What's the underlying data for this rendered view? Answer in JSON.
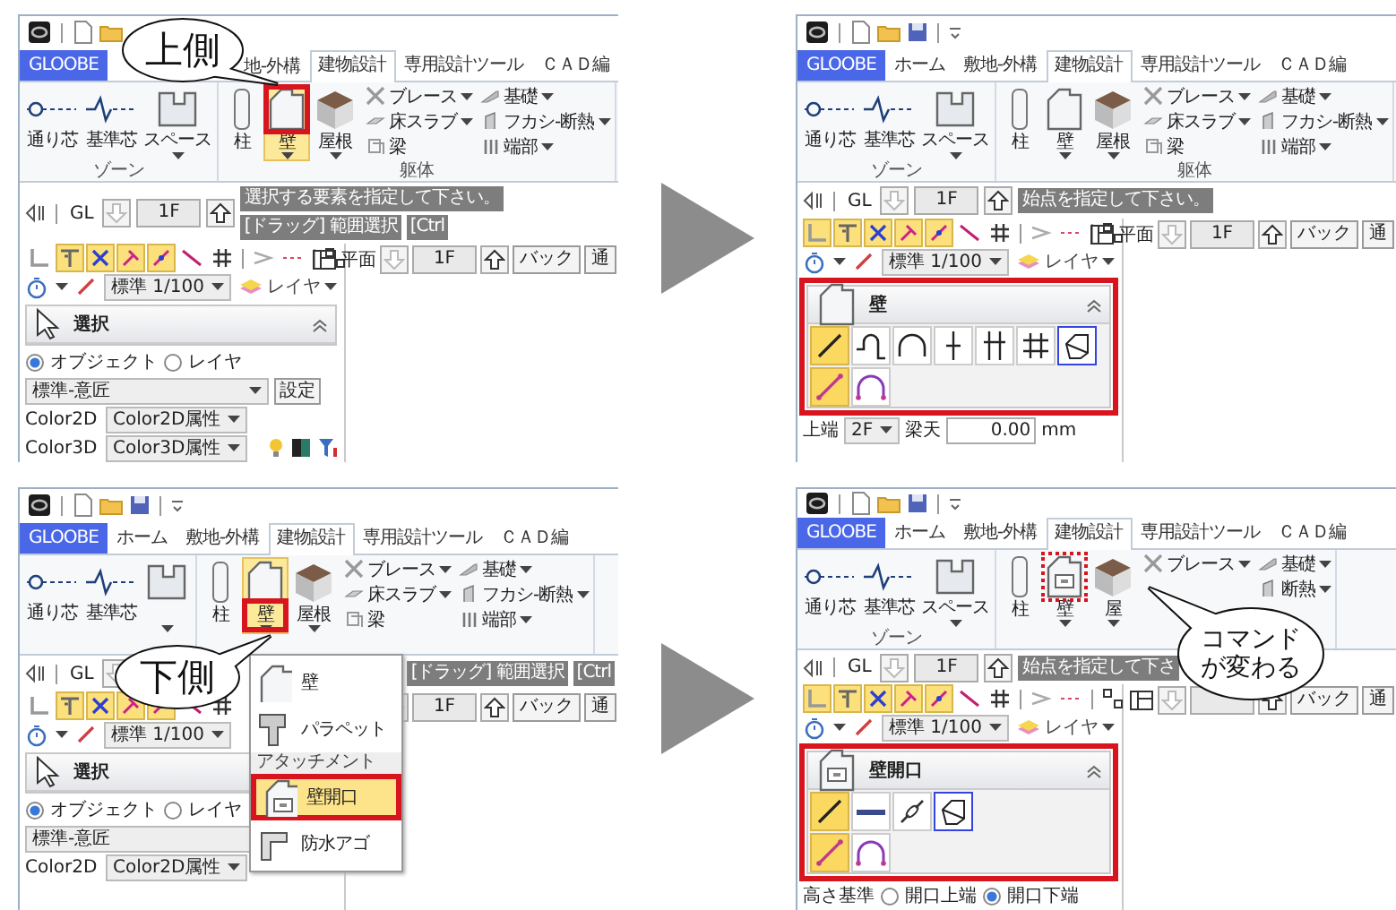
{
  "panels": [
    {
      "quick_access": [
        {
          "kind": "app"
        },
        {
          "kind": "doc"
        },
        {
          "kind": "folder"
        }
      ],
      "tabs": [
        {
          "label": "GLOOBE",
          "kind": "app",
          "selected": false
        },
        {
          "label": "地-外構",
          "kind": "partial",
          "selected": false
        },
        {
          "label": "建物設計",
          "kind": "tab",
          "selected": true
        },
        {
          "label": "専用設計ツール",
          "kind": "tab",
          "selected": false
        },
        {
          "label": "ＣＡＤ編",
          "kind": "tab",
          "selected": false
        }
      ],
      "zone": {
        "items": [
          {
            "label": "通り芯",
            "kind": "grid",
            "dropdown": false
          },
          {
            "label": "基準芯",
            "kind": "ref",
            "dropdown": false
          },
          {
            "label": "スペース",
            "kind": "space",
            "dropdown": true
          }
        ],
        "label": "ゾーン"
      },
      "body": {
        "items": [
          {
            "label": "柱",
            "kind": "column",
            "selected": false,
            "dropdown": false,
            "highlight": false
          },
          {
            "label": "壁",
            "kind": "wall",
            "selected": true,
            "dropdown": true,
            "highlight": true,
            "frame_on_label": false,
            "dotted": false
          },
          {
            "label": "屋根",
            "kind": "roof",
            "selected": false,
            "dropdown": true,
            "highlight": false
          }
        ],
        "small_columns": [
          [
            {
              "label": "ブレース",
              "kind": "brace",
              "dropdown": true
            },
            {
              "label": "床スラブ",
              "kind": "slab",
              "dropdown": true
            },
            {
              "label": "梁",
              "kind": "beam",
              "dropdown": false
            }
          ],
          [
            {
              "label": "基礎",
              "kind": "found",
              "dropdown": true
            },
            {
              "label": "フカシ-断熱",
              "kind": "fukashi",
              "dropdown": true
            },
            {
              "label": "端部",
              "kind": "end",
              "dropdown": true
            }
          ]
        ],
        "label": "躯体"
      },
      "level_bar": {
        "base": "GL",
        "floor": "1F",
        "messages": [
          "選択する要素を指定して下さい。",
          "[ドラッグ] 範囲選択",
          "[Ctrl"
        ]
      },
      "snap_tools": [
        {
          "kind": "corner",
          "selected": false
        },
        {
          "kind": "tee",
          "selected": true
        },
        {
          "kind": "cross",
          "selected": true
        },
        {
          "kind": "pin",
          "selected": true
        },
        {
          "kind": "diag",
          "selected": true
        },
        {
          "kind": "line",
          "selected": false
        },
        {
          "kind": "hash",
          "selected": false
        },
        {
          "kind": "chev",
          "selected": false
        },
        {
          "kind": "dash",
          "selected": false
        },
        {
          "kind": "dxdy",
          "selected": false
        }
      ],
      "scale": "標準 1/100",
      "layer": "レイヤ",
      "view_bar": {
        "view": "平面",
        "floor": "1F",
        "back": "バック",
        "mode": "通"
      },
      "command_panel": {
        "kind": "select",
        "title": "選択",
        "highlighted": false,
        "radios": [
          {
            "label": "オブジェクト",
            "selected": true
          },
          {
            "label": "レイヤ",
            "selected": false
          }
        ],
        "preset": "標準-意匠",
        "settings": "設定",
        "colors": [
          {
            "label": "Color2D",
            "value": "Color2D属性"
          },
          {
            "label": "Color3D",
            "value": "Color3D属性"
          }
        ]
      },
      "callout": {
        "lines": [
          "上側"
        ]
      }
    },
    {
      "quick_access": [
        {
          "kind": "app"
        },
        {
          "kind": "doc"
        },
        {
          "kind": "folder"
        },
        {
          "kind": "save"
        },
        {
          "kind": "qa"
        }
      ],
      "tabs": [
        {
          "label": "GLOOBE",
          "kind": "app",
          "selected": false
        },
        {
          "label": "ホーム",
          "kind": "tab",
          "selected": false
        },
        {
          "label": "敷地-外構",
          "kind": "tab",
          "selected": false
        },
        {
          "label": "建物設計",
          "kind": "tab",
          "selected": true
        },
        {
          "label": "専用設計ツール",
          "kind": "tab",
          "selected": false
        },
        {
          "label": "ＣＡＤ編",
          "kind": "tab",
          "selected": false
        }
      ],
      "zone": {
        "items": [
          {
            "label": "通り芯",
            "kind": "grid",
            "dropdown": false
          },
          {
            "label": "基準芯",
            "kind": "ref",
            "dropdown": false
          },
          {
            "label": "スペース",
            "kind": "space",
            "dropdown": true
          }
        ],
        "label": "ゾーン"
      },
      "body": {
        "items": [
          {
            "label": "柱",
            "kind": "column",
            "selected": false,
            "dropdown": false,
            "highlight": false
          },
          {
            "label": "壁",
            "kind": "wall",
            "selected": false,
            "dropdown": true,
            "highlight": false
          },
          {
            "label": "屋根",
            "kind": "roof",
            "selected": false,
            "dropdown": true,
            "highlight": false
          }
        ],
        "small_columns": [
          [
            {
              "label": "ブレース",
              "kind": "brace",
              "dropdown": true
            },
            {
              "label": "床スラブ",
              "kind": "slab",
              "dropdown": true
            },
            {
              "label": "梁",
              "kind": "beam",
              "dropdown": false
            }
          ],
          [
            {
              "label": "基礎",
              "kind": "found",
              "dropdown": true
            },
            {
              "label": "フカシ-断熱",
              "kind": "fukashi",
              "dropdown": true
            },
            {
              "label": "端部",
              "kind": "end",
              "dropdown": true
            }
          ]
        ],
        "label": "躯体"
      },
      "level_bar": {
        "base": "GL",
        "floor": "1F",
        "messages": [
          "始点を指定して下さい。"
        ]
      },
      "snap_tools": [
        {
          "kind": "corner",
          "selected": true
        },
        {
          "kind": "tee",
          "selected": true
        },
        {
          "kind": "cross",
          "selected": true
        },
        {
          "kind": "pin",
          "selected": true
        },
        {
          "kind": "diag",
          "selected": true
        },
        {
          "kind": "line",
          "selected": false
        },
        {
          "kind": "hash",
          "selected": false
        },
        {
          "kind": "chev",
          "selected": false
        },
        {
          "kind": "dash",
          "selected": false
        },
        {
          "kind": "dxdy",
          "selected": false
        }
      ],
      "scale": "標準 1/100",
      "layer": "レイヤ",
      "view_bar": {
        "view": "平面",
        "floor": "1F",
        "back": "バック",
        "mode": "通"
      },
      "command_panel": {
        "kind": "wall",
        "title": "壁",
        "highlighted": true,
        "tool_rows": [
          [
            {
              "kind": "line",
              "selected": true,
              "outlined": false
            },
            {
              "kind": "polyarc",
              "selected": false,
              "outlined": false
            },
            {
              "kind": "arc",
              "selected": false,
              "outlined": false
            },
            {
              "kind": "split",
              "selected": false,
              "outlined": false
            },
            {
              "kind": "split2",
              "selected": false,
              "outlined": false
            },
            {
              "kind": "grid",
              "selected": false,
              "outlined": false
            },
            {
              "kind": "region",
              "selected": false,
              "outlined": true
            }
          ],
          [
            {
              "kind": "line2",
              "selected": true,
              "outlined": false
            },
            {
              "kind": "arc2",
              "selected": false,
              "outlined": false
            }
          ]
        ],
        "top_row": {
          "label": "上端",
          "floor": "2F",
          "ref": "梁天",
          "value": "0.00",
          "unit": "mm"
        }
      }
    },
    {
      "quick_access": [
        {
          "kind": "app"
        },
        {
          "kind": "doc"
        },
        {
          "kind": "folder"
        },
        {
          "kind": "save"
        },
        {
          "kind": "qa"
        }
      ],
      "tabs": [
        {
          "label": "GLOOBE",
          "kind": "app",
          "selected": false
        },
        {
          "label": "ホーム",
          "kind": "tab",
          "selected": false
        },
        {
          "label": "敷地-外構",
          "kind": "tab",
          "selected": false
        },
        {
          "label": "建物設計",
          "kind": "tab",
          "selected": true
        },
        {
          "label": "専用設計ツール",
          "kind": "tab",
          "selected": false
        },
        {
          "label": "ＣＡＤ編",
          "kind": "tab",
          "selected": false
        }
      ],
      "zone": {
        "items": [
          {
            "label": "通り芯",
            "kind": "grid",
            "dropdown": false
          },
          {
            "label": "基準芯",
            "kind": "ref",
            "dropdown": false
          },
          {
            "kind": "space",
            "dropdown": true
          }
        ]
      },
      "body": {
        "items": [
          {
            "label": "柱",
            "kind": "column",
            "selected": false,
            "dropdown": false,
            "highlight": false
          },
          {
            "label": "壁",
            "kind": "wall",
            "selected": true,
            "dropdown": true,
            "highlight": true,
            "frame_on_label": true,
            "dotted": false
          },
          {
            "label": "屋根",
            "kind": "roof",
            "selected": false,
            "dropdown": true,
            "highlight": false
          }
        ],
        "small_columns": [
          [
            {
              "label": "ブレース",
              "kind": "brace",
              "dropdown": true
            },
            {
              "label": "床スラブ",
              "kind": "slab",
              "dropdown": true
            },
            {
              "label": "梁",
              "kind": "beam",
              "dropdown": false
            }
          ],
          [
            {
              "label": "基礎",
              "kind": "found",
              "dropdown": true
            },
            {
              "label": "フカシ-断熱",
              "kind": "fukashi",
              "dropdown": true
            },
            {
              "label": "端部",
              "kind": "end",
              "dropdown": true
            }
          ]
        ]
      },
      "level_bar": {
        "base": "GL",
        "messages": [
          "[ドラッグ] 範囲選択",
          "[Ctrl"
        ]
      },
      "snap_tools": [
        {
          "kind": "corner",
          "selected": false
        },
        {
          "kind": "tee",
          "selected": true
        },
        {
          "kind": "cross",
          "selected": true
        },
        {
          "kind": "pin",
          "selected": true
        },
        {
          "kind": "diag",
          "selected": true
        },
        {
          "kind": "line",
          "selected": false
        },
        {
          "kind": "hash",
          "selected": false
        }
      ],
      "scale": "標準 1/100",
      "view_bar": {
        "floor": "1F",
        "back": "バック",
        "mode": "通"
      },
      "command_panel": {
        "kind": "select",
        "title": "選択",
        "highlighted": false,
        "radios": [
          {
            "label": "オブジェクト",
            "selected": true
          },
          {
            "label": "レイヤ",
            "selected": false
          }
        ],
        "preset": "標準-意匠",
        "colors": [
          {
            "label": "Color2D",
            "value": "Color2D属性"
          }
        ]
      },
      "menu": {
        "items": [
          {
            "label": "壁",
            "kind": "wall",
            "selected": false,
            "highlight": false
          },
          {
            "label": "パラペット",
            "kind": "parapet",
            "selected": false,
            "highlight": false
          },
          {
            "label": "アタッチメント",
            "kind": "header"
          },
          {
            "label": "壁開口",
            "kind": "opening",
            "selected": true,
            "highlight": true
          },
          {
            "label": "防水アゴ",
            "kind": "flashing",
            "selected": false,
            "highlight": false
          }
        ]
      },
      "callout": {
        "lines": [
          "下側"
        ]
      }
    },
    {
      "quick_access": [
        {
          "kind": "app"
        },
        {
          "kind": "doc"
        },
        {
          "kind": "folder"
        },
        {
          "kind": "save"
        },
        {
          "kind": "qa"
        }
      ],
      "tabs": [
        {
          "label": "GLOOBE",
          "kind": "app",
          "selected": false
        },
        {
          "label": "ホーム",
          "kind": "tab",
          "selected": false
        },
        {
          "label": "敷地-外構",
          "kind": "tab",
          "selected": false
        },
        {
          "label": "建物設計",
          "kind": "tab",
          "selected": true
        },
        {
          "label": "専用設計ツール",
          "kind": "tab",
          "selected": false
        },
        {
          "label": "ＣＡＤ編",
          "kind": "tab",
          "selected": false
        }
      ],
      "zone": {
        "items": [
          {
            "label": "通り芯",
            "kind": "grid",
            "dropdown": false
          },
          {
            "label": "基準芯",
            "kind": "ref",
            "dropdown": false
          },
          {
            "label": "スペース",
            "kind": "space",
            "dropdown": true
          }
        ],
        "label": "ゾーン"
      },
      "body": {
        "items": [
          {
            "label": "柱",
            "kind": "column",
            "selected": false,
            "dropdown": false,
            "highlight": false
          },
          {
            "label": "壁",
            "kind": "opening",
            "selected": false,
            "dropdown": true,
            "highlight": true,
            "frame_on_label": false,
            "dotted": true
          },
          {
            "label": "屋",
            "kind": "roof",
            "selected": false,
            "dropdown": true,
            "highlight": false
          }
        ],
        "small_columns": [
          [
            {
              "label": "ブレース",
              "kind": "brace",
              "dropdown": true
            }
          ],
          [
            {
              "label": "基礎",
              "kind": "found",
              "dropdown": true
            },
            {
              "label": "断熱",
              "kind": "fukashi",
              "dropdown": true
            }
          ]
        ]
      },
      "level_bar": {
        "base": "GL",
        "floor": "1F",
        "messages": [
          "始点を指定して下さ"
        ]
      },
      "snap_tools": [
        {
          "kind": "corner",
          "selected": true
        },
        {
          "kind": "tee",
          "selected": true
        },
        {
          "kind": "cross",
          "selected": true
        },
        {
          "kind": "pin",
          "selected": true
        },
        {
          "kind": "diag",
          "selected": true
        },
        {
          "kind": "line",
          "selected": false
        },
        {
          "kind": "hash",
          "selected": false
        },
        {
          "kind": "chev",
          "selected": false
        },
        {
          "kind": "dash",
          "selected": false
        },
        {
          "kind": "dxdy",
          "selected": false
        }
      ],
      "scale": "標準 1/100",
      "layer": "レイヤ",
      "view_bar": {
        "back": "バック",
        "mode": "通"
      },
      "command_panel": {
        "kind": "opening",
        "title": "壁開口",
        "highlighted": true,
        "tool_rows": [
          [
            {
              "kind": "line",
              "selected": true,
              "outlined": false
            },
            {
              "kind": "bar",
              "selected": false,
              "outlined": false
            },
            {
              "kind": "chain",
              "selected": false,
              "outlined": false
            },
            {
              "kind": "region",
              "selected": false,
              "outlined": true
            }
          ],
          [
            {
              "kind": "line2",
              "selected": true,
              "outlined": false
            },
            {
              "kind": "arc2",
              "selected": false,
              "outlined": false
            }
          ]
        ],
        "height_row": {
          "label": "高さ基準",
          "radios": [
            {
              "label": "開口上端",
              "selected": false
            },
            {
              "label": "開口下端",
              "selected": true
            }
          ]
        }
      },
      "callout": {
        "lines": [
          "コマンド",
          "が変わる"
        ]
      }
    }
  ]
}
